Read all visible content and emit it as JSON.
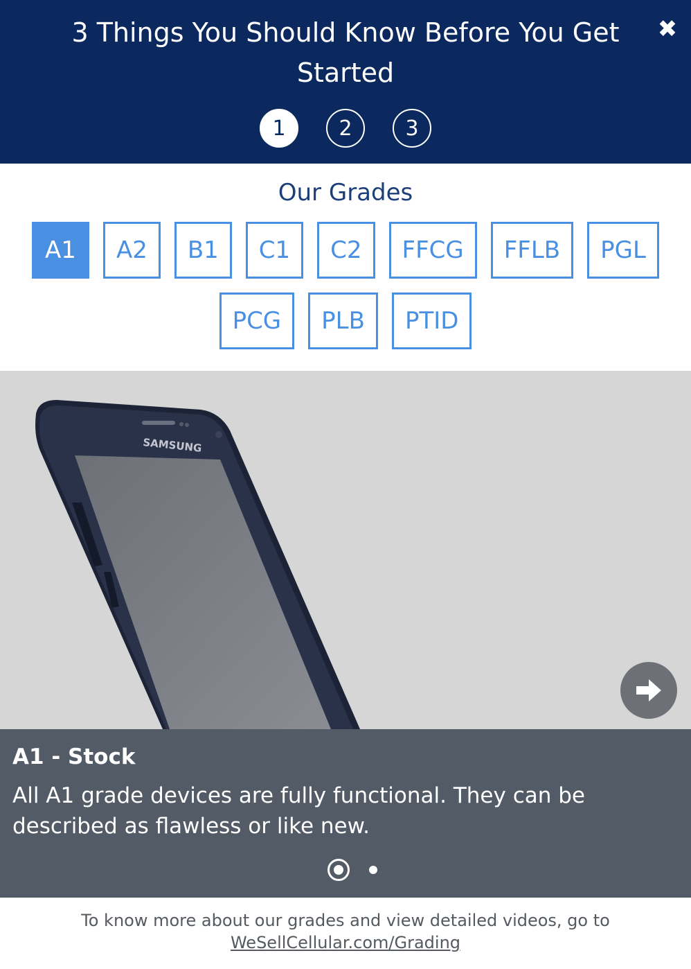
{
  "header": {
    "title": "3 Things You Should Know Before You Get Started",
    "close_label": "✖",
    "steps": [
      "1",
      "2",
      "3"
    ],
    "active_step": "1"
  },
  "grades": {
    "title": "Our Grades",
    "row1": [
      "A1",
      "A2",
      "B1",
      "C1",
      "C2",
      "FFCG",
      "FFLB",
      "PGL"
    ],
    "row2": [
      "PCG",
      "PLB",
      "PTID"
    ],
    "selected": "A1"
  },
  "slide": {
    "image": "samsung-phone",
    "brand_text": "SAMSUNG",
    "caption_title": "A1 - Stock",
    "caption_text": "All A1 grade devices are fully functional. They can be described as flawless or like new.",
    "next_icon": "arrow-right-icon",
    "pagination": {
      "total": 2,
      "active": 1
    }
  },
  "footer": {
    "text": "To know more about our grades and view detailed videos, go to",
    "link": "WeSellCellular.com/Grading"
  },
  "colors": {
    "header_bg": "#0b295e",
    "accent": "#4a90e2",
    "caption_bg": "#535b66",
    "slider_bg": "#d6d6d6"
  }
}
